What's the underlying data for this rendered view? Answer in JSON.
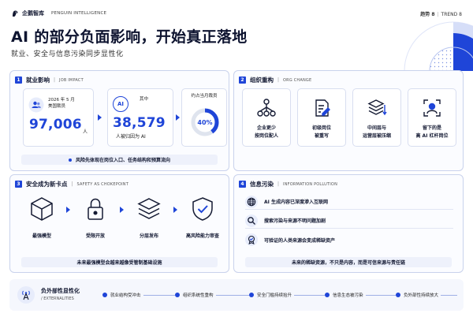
{
  "header": {
    "brand_name": "企鹅智库",
    "brand_en": "PENGUIN INTELLIGENCE",
    "trend_cn": "趋势 8",
    "trend_en": "TREND 8"
  },
  "hero": {
    "title": "AI 的部分负面影响，开始真正落地",
    "subtitle": "就业、安全与信息污染同步显性化"
  },
  "colors": {
    "accent": "#1f45d8",
    "light": "#e7ecfb",
    "border": "#c9d2ec"
  },
  "job_impact": {
    "num": "1",
    "title": "就业影响",
    "en": "JOB IMPACT",
    "card_a": {
      "line1": "2026 年 5 月",
      "line2": "美国裁员",
      "value": "97,006",
      "unit": "人"
    },
    "card_b": {
      "badge": "AI",
      "line1": "其中",
      "value": "38,579",
      "unit": "人被归因为 AI"
    },
    "card_c": {
      "line1": "约占当月裁员",
      "percent": "40%",
      "fraction": 0.4
    },
    "footer": "风险先体现在岗位入口、任务结构和预算流向"
  },
  "org_change": {
    "num": "2",
    "title": "组织重构",
    "en": "ORG CHANGE",
    "cards": [
      {
        "icon": "org-tree-icon",
        "label": [
          "企业更少",
          "按岗位配人"
        ]
      },
      {
        "icon": "document-edit-icon",
        "label": [
          "初级岗位",
          "被重写"
        ]
      },
      {
        "icon": "layers-compress-icon",
        "label": [
          "中间层与",
          "运营层被压缩"
        ]
      },
      {
        "icon": "person-focus-icon",
        "label": [
          "留下的是",
          "高 AI 杠杆岗位"
        ]
      }
    ]
  },
  "chokepoint": {
    "num": "3",
    "title": "安全成为新卡点",
    "en": "SAFETY AS CHOKEPOINT",
    "items": [
      {
        "icon": "cube-icon",
        "label": "最强模型"
      },
      {
        "icon": "lock-icon",
        "label": "受限开放"
      },
      {
        "icon": "layers-icon",
        "label": "分层发布"
      },
      {
        "icon": "shield-check-icon",
        "label": "高风险能力审查"
      }
    ],
    "footer": "未来最强模型会越来越像受管制基础设施"
  },
  "info_pollution": {
    "num": "4",
    "title": "信息污染",
    "en": "INFORMATION POLLUTION",
    "rows": [
      {
        "icon": "globe-icon",
        "text": "AI 生成内容已深度渗入互联网"
      },
      {
        "icon": "search-icon",
        "text": "搜索污染与来源不明问题加剧"
      },
      {
        "icon": "verified-badge-icon",
        "text": "可验证的人类来源会变成稀缺资产"
      }
    ],
    "footer": "未来的稀缺资源，不只是内容，而是可信来源与责任链"
  },
  "externalities": {
    "title": "负外部性显性化",
    "en": "/ EXTERNALITIES",
    "steps": [
      "就业结构受冲击",
      "组织系统性重构",
      "安全门槛持续抬升",
      "信息生态被污染",
      "负外部性持续放大"
    ]
  }
}
